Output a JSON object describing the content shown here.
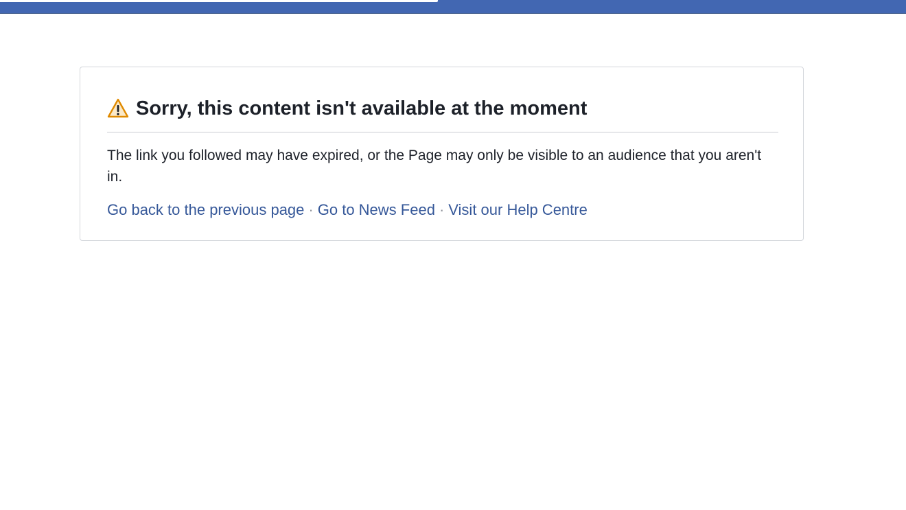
{
  "header": {
    "bar_color": "#4267b2"
  },
  "error_card": {
    "icon": "warning-triangle-icon",
    "icon_color": "#f7a600",
    "title": "Sorry, this content isn't available at the moment",
    "message": "The link you followed may have expired, or the Page may only be visible to an audience that you aren't in.",
    "links": [
      {
        "label": "Go back to the previous page"
      },
      {
        "label": "Go to News Feed"
      },
      {
        "label": "Visit our Help Centre"
      }
    ],
    "separator": "·",
    "link_color": "#365899"
  }
}
